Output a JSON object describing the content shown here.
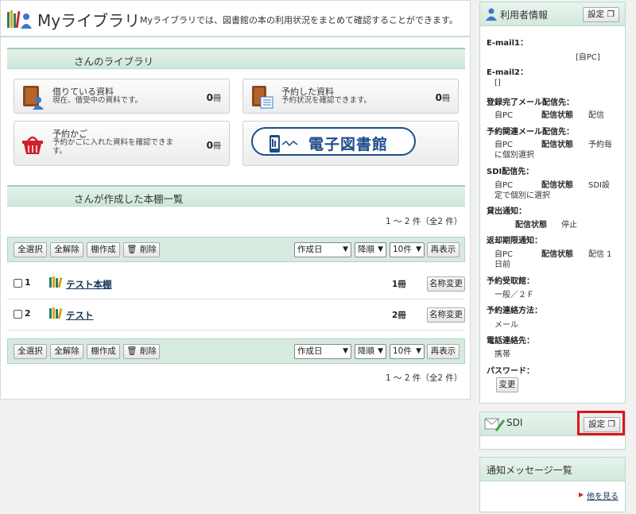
{
  "header": {
    "title": "Myライブラリ",
    "description": "Myライブラリでは、図書館の本の利用状況をまとめて確認することができます。"
  },
  "library_section": {
    "title": "さんのライブラリ"
  },
  "cards": [
    {
      "title": "借りている資料",
      "subtitle": "現在、借受中の資料です。",
      "count": "0",
      "unit": "冊",
      "icon": "book-person-icon"
    },
    {
      "title": "予約した資料",
      "subtitle": "予約状況を確認できます。",
      "count": "0",
      "unit": "冊",
      "icon": "book-list-icon"
    },
    {
      "title": "予約かご",
      "subtitle": "予約かごに入れた資料を確認できます。",
      "count": "0",
      "unit": "冊",
      "icon": "basket-icon"
    }
  ],
  "ebook_banner": {
    "label": "電子図書館"
  },
  "shelf_section": {
    "title": "さんが作成した本棚一覧"
  },
  "pager_text": "1 ～ 2 件（全2 件）",
  "toolbar": {
    "select_all": "全選択",
    "deselect_all": "全解除",
    "create_shelf": "棚作成",
    "delete": "削除",
    "sort_field": "作成日",
    "sort_order": "降順",
    "per_page": "10件",
    "redisplay": "再表示"
  },
  "shelves": [
    {
      "num": "1",
      "name": "テスト本棚",
      "count": "1冊",
      "rename": "名称変更"
    },
    {
      "num": "2",
      "name": "テスト",
      "count": "2冊",
      "rename": "名称変更"
    }
  ],
  "user_info": {
    "title": "利用者情報",
    "settings_button": "設定",
    "email1_label": "E-mail1：",
    "email1_value": "[自PC]",
    "email2_label": "E-mail2：",
    "email2_value": "[]",
    "reg_mail_label": "登録完了メール配信先：",
    "reg_mail_dest": "自PC",
    "reg_mail_status_label": "配信状態",
    "reg_mail_status": "配信",
    "res_mail_label": "予約関連メール配信先：",
    "res_mail_dest": "自PC",
    "res_mail_status_label": "配信状態",
    "res_mail_status": "予約毎",
    "res_mail_status2": "に個別選択",
    "sdi_label": "SDI配信先：",
    "sdi_dest": "自PC",
    "sdi_status_label": "配信状態",
    "sdi_status": "SDI設",
    "sdi_status2": "定で個別に選択",
    "loan_label": "貸出通知：",
    "loan_status_label": "配信状態",
    "loan_status": "停止",
    "due_label": "返却期限通知：",
    "due_dest": "自PC",
    "due_status_label": "配信状態",
    "due_status": "配信 1",
    "due_status2": "日前",
    "pickup_label": "予約受取館：",
    "pickup_value": "一般／２Ｆ",
    "contact_label": "予約連絡方法：",
    "contact_value": "メール",
    "phone_label": "電話連絡先：",
    "phone_value": "携帯",
    "password_label": "パスワード：",
    "password_button": "変更"
  },
  "sdi_panel": {
    "title": "SDI",
    "settings_button": "設定"
  },
  "notice_panel": {
    "title": "通知メッセージ一覧",
    "more_link": "他を見る"
  },
  "colors": {
    "accent_green": "#9ccfb4",
    "highlight_red": "#e0141b",
    "ebook_blue": "#1f4c8c"
  }
}
